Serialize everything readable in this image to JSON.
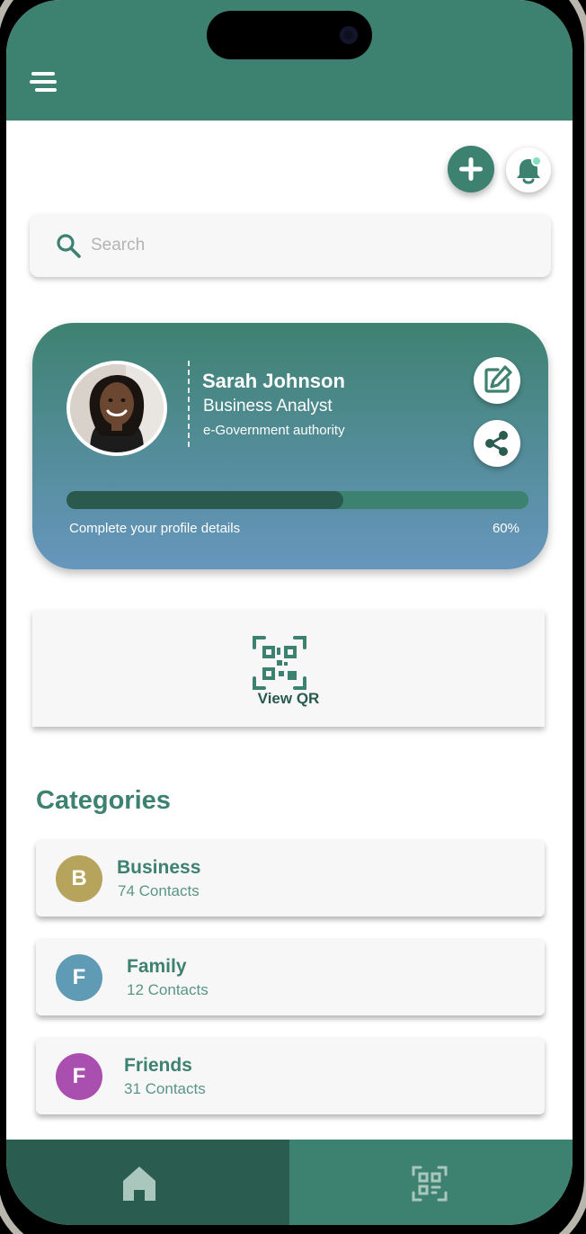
{
  "app": {
    "accent": "#3d8170",
    "accent_dark": "#2a5d4f"
  },
  "header": {
    "menu_icon": "hamburger-menu-icon"
  },
  "actions": {
    "add_icon": "plus-icon",
    "notifications_icon": "bell-icon"
  },
  "search": {
    "placeholder": "Search",
    "value": ""
  },
  "profile": {
    "name": "Sarah Johnson",
    "role": "Business Analyst",
    "organization": "e-Government authority",
    "edit_icon": "edit-icon",
    "share_icon": "share-icon",
    "progress_label": "Complete your profile details",
    "progress_percent_label": "60%",
    "progress_value": 0.6
  },
  "qr": {
    "label": "View QR",
    "icon": "qr-code-icon"
  },
  "categories": {
    "title": "Categories",
    "items": [
      {
        "initial": "B",
        "name": "Business",
        "count": "74 Contacts",
        "color": "#b6a45c"
      },
      {
        "initial": "F",
        "name": "Family",
        "count": "12 Contacts",
        "color": "#5f9bb5"
      },
      {
        "initial": "F",
        "name": "Friends",
        "count": "31 Contacts",
        "color": "#a94fb0"
      }
    ]
  },
  "bottom_nav": {
    "home_icon": "home-icon",
    "qr_icon": "qr-scan-icon"
  }
}
